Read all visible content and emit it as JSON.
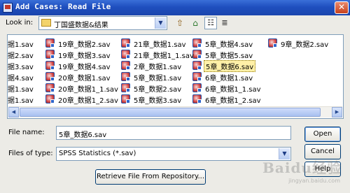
{
  "window": {
    "title": "Add Cases: Read File",
    "close_glyph": "✕"
  },
  "toolbar": {
    "look_in_label": "Look in:",
    "look_in_value": "丁国盛数据&结果",
    "up_icon": "folder-up-icon",
    "home_icon": "home-icon",
    "list_view_icon": "list-view-icon",
    "details_view_icon": "details-view-icon"
  },
  "files": [
    {
      "name": "据1.sav",
      "col": 0,
      "row": 0,
      "partial": true
    },
    {
      "name": "据2.sav",
      "col": 0,
      "row": 1,
      "partial": true
    },
    {
      "name": "据3.sav",
      "col": 0,
      "row": 2,
      "partial": true
    },
    {
      "name": "据4.sav",
      "col": 0,
      "row": 3,
      "partial": true
    },
    {
      "name": "据1.sav",
      "col": 0,
      "row": 4,
      "partial": true
    },
    {
      "name": "据1.sav",
      "col": 0,
      "row": 5,
      "partial": true
    },
    {
      "name": "19章_数据2.sav",
      "col": 1,
      "row": 0
    },
    {
      "name": "19章_数据3.sav",
      "col": 1,
      "row": 1
    },
    {
      "name": "19章_数据4.sav",
      "col": 1,
      "row": 2
    },
    {
      "name": "20章_数据1.sav",
      "col": 1,
      "row": 3
    },
    {
      "name": "20章_数据1_1.sav",
      "col": 1,
      "row": 4
    },
    {
      "name": "20章_数据1_2.sav",
      "col": 1,
      "row": 5
    },
    {
      "name": "21章_数据1.sav",
      "col": 2,
      "row": 0
    },
    {
      "name": "21章_数据1_1.sav",
      "col": 2,
      "row": 1
    },
    {
      "name": "2章_数据1.sav",
      "col": 2,
      "row": 2
    },
    {
      "name": "5章_数据1.sav",
      "col": 2,
      "row": 3
    },
    {
      "name": "5章_数据2.sav",
      "col": 2,
      "row": 4
    },
    {
      "name": "5章_数据3.sav",
      "col": 2,
      "row": 5
    },
    {
      "name": "5章_数据4.sav",
      "col": 3,
      "row": 0
    },
    {
      "name": "5章_数据5.sav",
      "col": 3,
      "row": 1
    },
    {
      "name": "5章_数据6.sav",
      "col": 3,
      "row": 2,
      "selected": true
    },
    {
      "name": "6章_数据1.sav",
      "col": 3,
      "row": 3
    },
    {
      "name": "6章_数据1_1.sav",
      "col": 3,
      "row": 4
    },
    {
      "name": "6章_数据1_2.sav",
      "col": 3,
      "row": 5
    },
    {
      "name": "9章_数据2.sav",
      "col": 4,
      "row": 0
    }
  ],
  "form": {
    "file_name_label": "File name:",
    "file_name_value": "5章_数据6.sav",
    "files_of_type_label": "Files of type:",
    "files_of_type_value": "SPSS Statistics (*.sav)",
    "retrieve_button": "Retrieve File From Repository...",
    "open_button": "Open",
    "cancel_button": "Cancel",
    "help_button": "Help"
  },
  "watermark": {
    "logo": "Baidu经验",
    "sub": "jingyan.baidu.com"
  }
}
